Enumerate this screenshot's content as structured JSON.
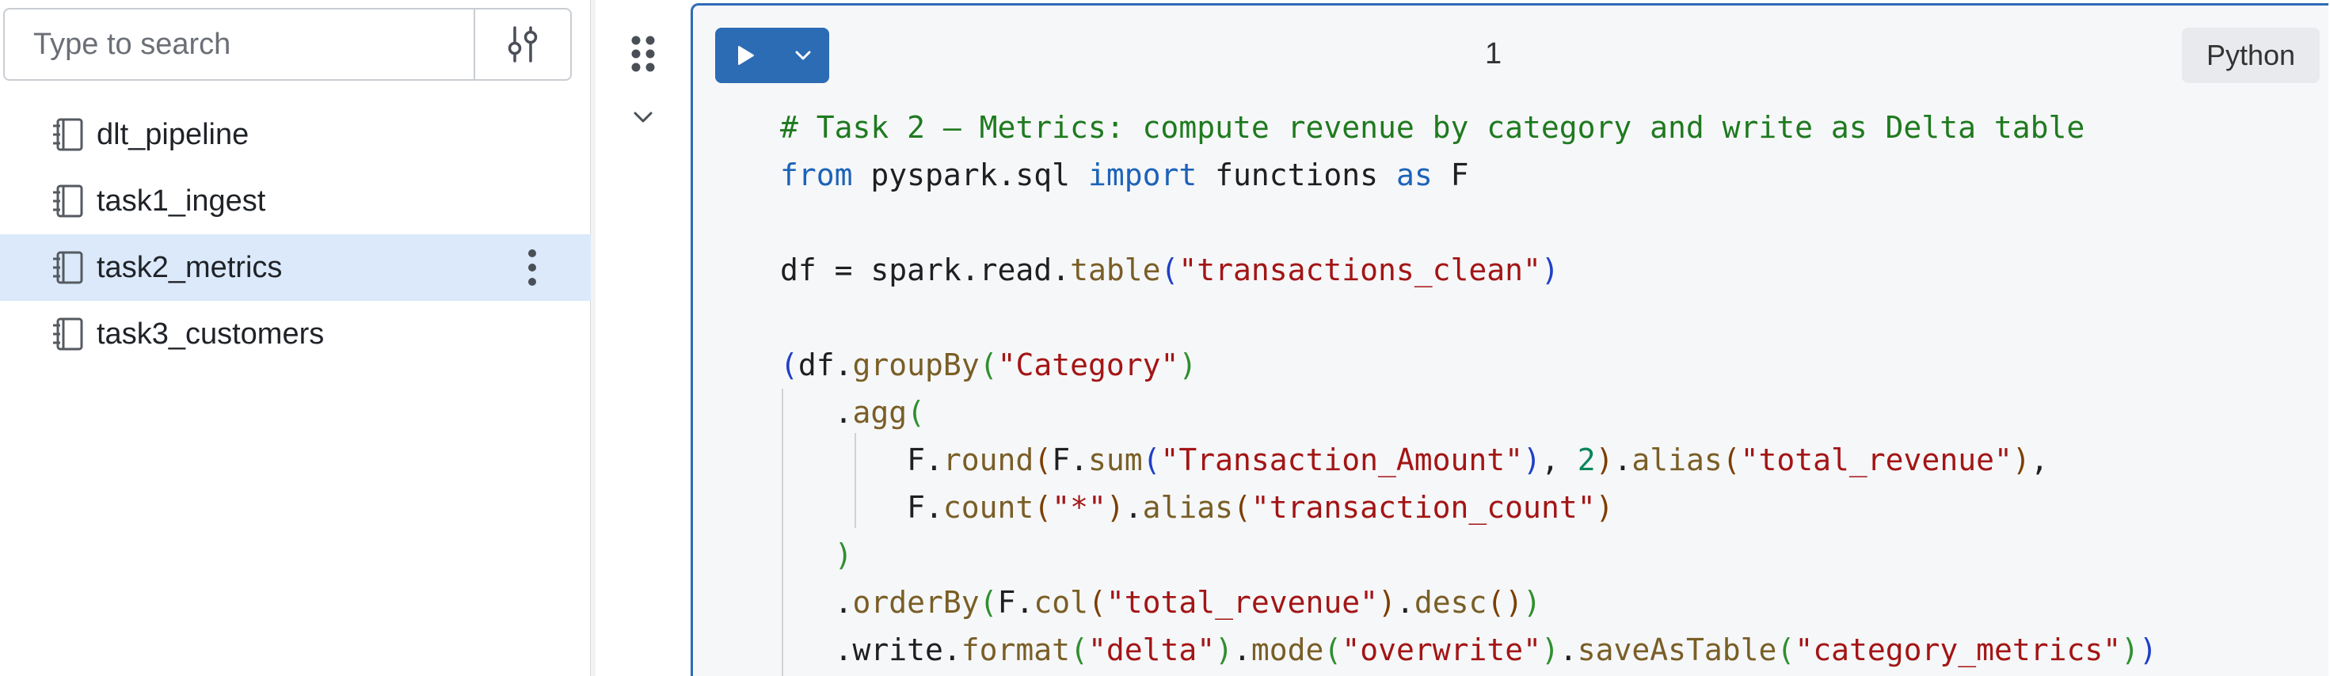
{
  "sidebar": {
    "search": {
      "placeholder": "Type to search",
      "value": ""
    },
    "files": [
      {
        "label": "dlt_pipeline",
        "selected": false
      },
      {
        "label": "task1_ingest",
        "selected": false
      },
      {
        "label": "task2_metrics",
        "selected": true
      },
      {
        "label": "task3_customers",
        "selected": false
      }
    ]
  },
  "cell": {
    "number": "1",
    "language": "Python",
    "accent_color": "#2c6cb4"
  },
  "code": {
    "comment": "# Task 2 — Metrics: compute revenue by category and write as Delta table",
    "import": {
      "from": "from",
      "module": "pyspark.sql",
      "import": "import",
      "name": "functions",
      "as": "as",
      "alias": "F"
    },
    "read": {
      "var": "df",
      "prefix": "spark.read.",
      "fn": "table",
      "arg": "\"transactions_clean\""
    },
    "group": {
      "var": "df",
      "fn": "groupBy",
      "arg": "\"Category\""
    },
    "agg": {
      "fn": "agg"
    },
    "sum_line": {
      "round": "round",
      "sum": "sum",
      "col": "\"Transaction_Amount\"",
      "digits": "2",
      "alias": "alias",
      "alias_arg": "\"total_revenue\""
    },
    "count_line": {
      "count": "count",
      "arg": "\"*\"",
      "alias": "alias",
      "alias_arg": "\"transaction_count\""
    },
    "order": {
      "fn": "orderBy",
      "col": "col",
      "arg": "\"total_revenue\"",
      "desc": "desc"
    },
    "write": {
      "prefix": ".write.",
      "format": "format",
      "format_arg": "\"delta\"",
      "mode": "mode",
      "mode_arg": "\"overwrite\"",
      "save": "saveAsTable",
      "save_arg": "\"category_metrics\""
    }
  }
}
